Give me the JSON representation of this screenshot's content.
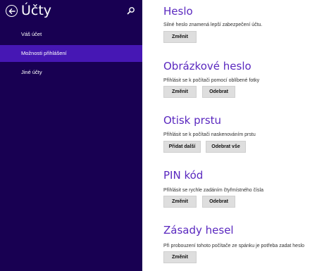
{
  "sidebar": {
    "title": "Účty",
    "items": [
      {
        "label": "Váš účet",
        "selected": false
      },
      {
        "label": "Možnosti přihlášení",
        "selected": true
      },
      {
        "label": "Jiné účty",
        "selected": false
      }
    ]
  },
  "sections": [
    {
      "title": "Heslo",
      "description": "Silné heslo znamená lepší zabezpečení účtu.",
      "buttons": [
        "Změnit"
      ]
    },
    {
      "title": "Obrázkové heslo",
      "description": "Přihlásit se k počítači pomocí oblíbené fotky",
      "buttons": [
        "Změnit",
        "Odebrat"
      ]
    },
    {
      "title": "Otisk prstu",
      "description": "Přihlásit se k počítači naskenováním prstu",
      "buttons": [
        "Přidat další",
        "Odebrat vše"
      ]
    },
    {
      "title": "PIN kód",
      "description": "Přihlásit se rychle zadáním čtyřmístného čísla",
      "buttons": [
        "Změnit",
        "Odebrat"
      ]
    },
    {
      "title": "Zásady hesel",
      "description": "Při probouzení tohoto počítače ze spánku je potřeba zadat heslo",
      "buttons": [
        "Změnit"
      ]
    }
  ],
  "colors": {
    "sidebar_bg": "#180052",
    "selected_bg": "#4617b4",
    "accent": "#5a28bf"
  },
  "icons": {
    "back": "back-arrow-circle-icon",
    "search": "search-icon"
  }
}
